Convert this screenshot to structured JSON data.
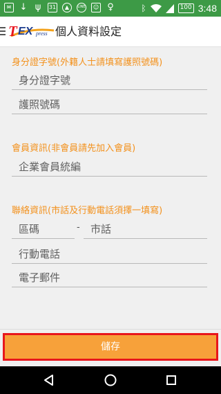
{
  "statusbar": {
    "calendar_day": "31",
    "line_label": "LINE",
    "battery": "100",
    "time": "3:48"
  },
  "appbar": {
    "logo_t": "T",
    "logo_ex": "EX",
    "logo_press": "press",
    "title": "個人資料設定"
  },
  "sections": {
    "id": {
      "header": "身分證字號(外籍人士請填寫護照號碼)",
      "id_placeholder": "身分證字號",
      "passport_placeholder": "護照號碼"
    },
    "member": {
      "header": "會員資訊(非會員請先加入會員)",
      "company_placeholder": "企業會員統編"
    },
    "contact": {
      "header": "聯絡資訊(市話及行動電話須擇一填寫)",
      "area_placeholder": "區碼",
      "separator": "-",
      "landline_placeholder": "市話",
      "mobile_placeholder": "行動電話",
      "email_placeholder": "電子郵件"
    }
  },
  "save_label": "儲存",
  "colors": {
    "statusbar": "#3d9a46",
    "accent": "#f3911c",
    "button": "#f7a13a",
    "button_border": "#e8161c"
  }
}
